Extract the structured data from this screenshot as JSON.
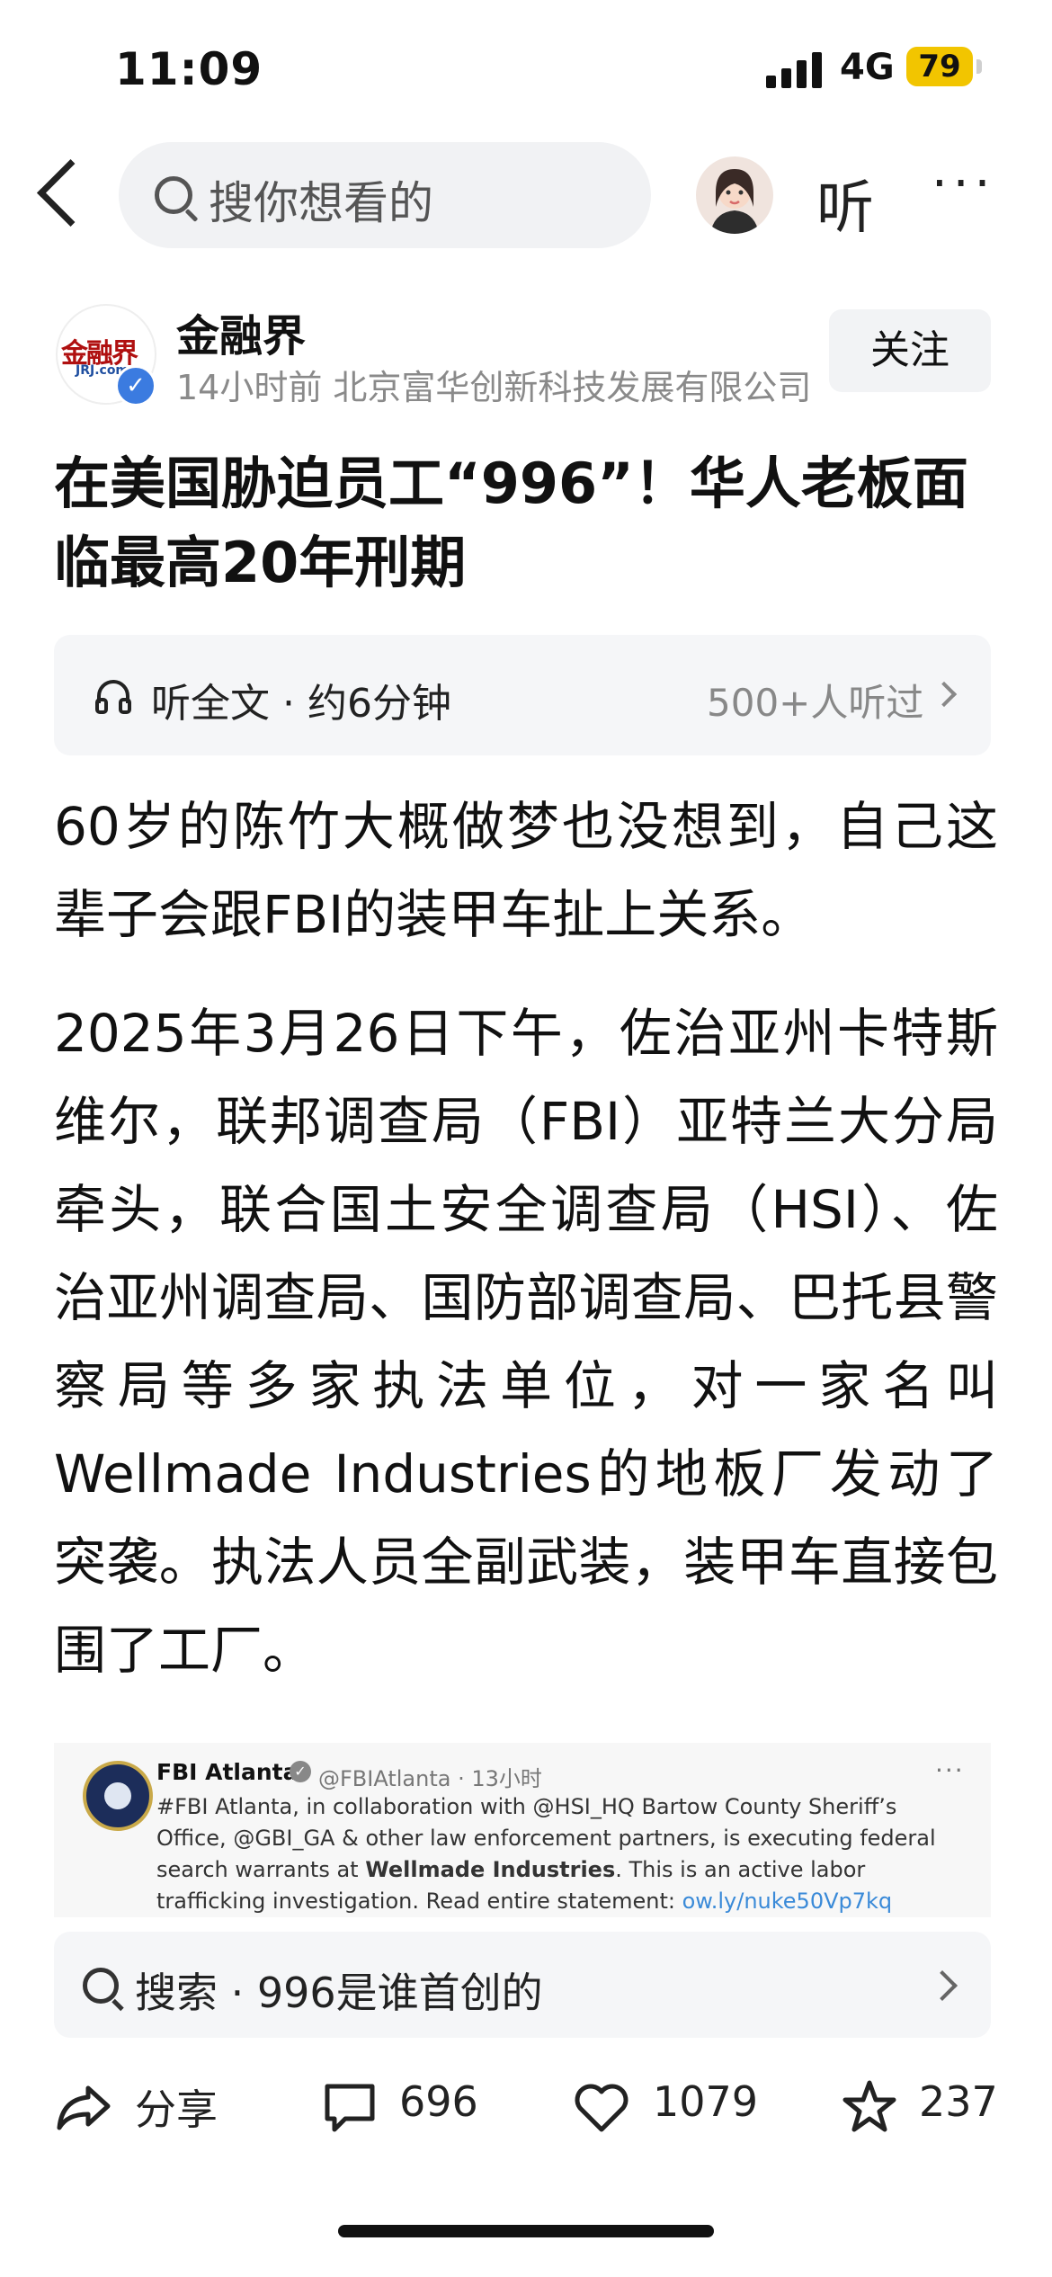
{
  "status_bar": {
    "time": "11:09",
    "network": "4G",
    "battery": "79"
  },
  "nav": {
    "search_placeholder": "搜你想看的",
    "listen_label": "听",
    "more_label": "···"
  },
  "author": {
    "name": "金融界",
    "logo_text": "金融界",
    "logo_sub": "JRJ.com",
    "meta": "14小时前  北京富华创新科技发展有限公司",
    "follow_label": "关注"
  },
  "article": {
    "title": "在美国胁迫员工“996”！华人老板面临最高20年刑期",
    "listen_full": "听全文 · 约6分钟",
    "listen_count": "500+人听过",
    "paragraphs": [
      "60岁的陈竹大概做梦也没想到，自己这辈子会跟FBI的装甲车扯上关系。",
      "2025年3月26日下午，佐治亚州卡特斯维尔，联邦调查局（FBI）亚特兰大分局牵头，联合国土安全调查局（HSI）、佐治亚州调查局、国防部调查局、巴托县警察局等多家执法单位，对一家名叫Wellmade Industries的地板厂发动了突袭。执法人员全副武装，装甲车直接包围了工厂。"
    ]
  },
  "tweet": {
    "name": "FBI Atlanta",
    "handle_time": "@FBIAtlanta · 13小时",
    "body_1": "#FBI Atlanta, in collaboration with @HSI_HQ Bartow County Sheriff’s Office, @GBI_GA & other law enforcement partners, is executing federal search warrants at ",
    "body_bold": "Wellmade Industries",
    "body_2": ". This is an active labor trafficking investigation. Read entire statement: ",
    "link": "ow.ly/nuke50Vp7kq"
  },
  "related_search": {
    "text": "搜索 · 996是谁首创的"
  },
  "actions": {
    "share": "分享",
    "comments": "696",
    "likes": "1079",
    "favorites": "237"
  }
}
